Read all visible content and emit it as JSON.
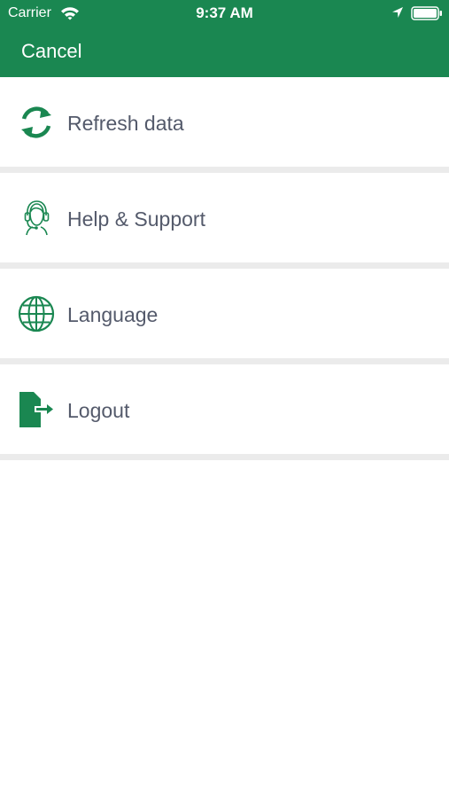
{
  "status_bar": {
    "carrier": "Carrier",
    "time": "9:37 AM"
  },
  "header": {
    "cancel_label": "Cancel",
    "background_color": "#1a8751"
  },
  "menu": {
    "icon_color": "#1a8751",
    "items": [
      {
        "label": "Refresh data",
        "icon": "refresh-icon"
      },
      {
        "label": "Help & Support",
        "icon": "headset-icon"
      },
      {
        "label": "Language",
        "icon": "globe-icon"
      },
      {
        "label": "Logout",
        "icon": "logout-icon"
      }
    ]
  }
}
